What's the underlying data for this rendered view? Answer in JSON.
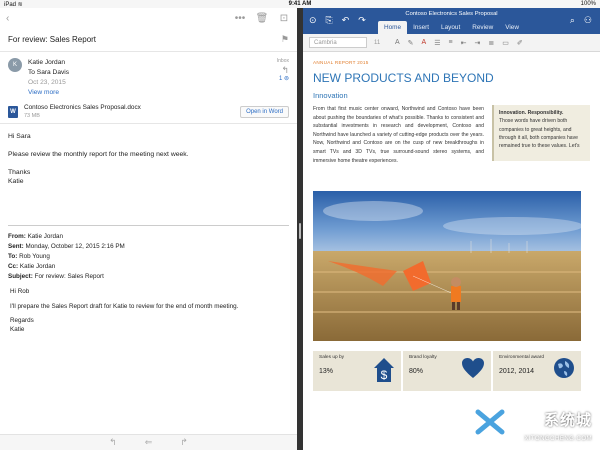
{
  "status": {
    "time": "9:41 AM",
    "battery": "100%"
  },
  "mail": {
    "subject": "For review: Sales Report",
    "sender_initial": "K",
    "sender_name": "Katie Jordan",
    "to": "To Sara Davis",
    "date": "Oct 23, 2015",
    "view_more": "View more",
    "inbox_label": "Inbox",
    "thread_count": "1",
    "attachment_name": "Contoso Electronics Sales Proposal.docx",
    "attachment_size": "73 MB",
    "attachment_type": "doc",
    "open_in_word": "Open in Word",
    "body": [
      "Hi Sara",
      "Please review the monthly report for the meeting next week.",
      "Thanks\nKatie"
    ],
    "quoted": {
      "from_label": "From:",
      "from": "Katie Jordan",
      "sent_label": "Sent:",
      "sent": "Monday, October 12, 2015 2:16 PM",
      "to_label": "To:",
      "to": "Rob Young",
      "cc_label": "Cc:",
      "cc": "Katie Jordan",
      "subject_label": "Subject:",
      "subject": "For review: Sales Report",
      "body": [
        "Hi Rob",
        "I'll prepare the Sales Report draft for Katie to review for the end of month meeting.",
        "Regards\nKatie"
      ]
    }
  },
  "word": {
    "doc_title": "Contoso Electronics Sales Proposal",
    "tabs": [
      "Home",
      "Insert",
      "Layout",
      "Review",
      "View"
    ],
    "active_tab": "Home",
    "font": "Cambria",
    "font_size": "11",
    "doc_header": "ANNUAL REPORT 2015",
    "title": "NEW PRODUCTS AND BEYOND",
    "subtitle": "Innovation",
    "paragraph": "From that first music center onward, Northwind and Contoso have been about pushing the boundaries of what's possible. Thanks to consistent and substantial investments in research and development, Contoso and Northwind have launched a variety of cutting-edge products over the years. Now, Northwind and Contoso are on the cusp of new breakthroughs in smart TVs and 3D TVs, true surround-sound stereo systems, and immersive home theatre experiences.",
    "sidebox_title": "Innovation. Responsibility.",
    "sidebox_text": "Those words have driven both companies to great heights, and through it all, both companies have remained true to these values. Let's",
    "stats": [
      {
        "label": "Sales up by",
        "value": "13%",
        "icon": "dollar-house-icon"
      },
      {
        "label": "Brand loyalty",
        "value": "80%",
        "icon": "heart-icon"
      },
      {
        "label": "Environmental award",
        "value": "2012, 2014",
        "icon": "globe-icon"
      }
    ]
  },
  "watermark": {
    "cn": "系统城",
    "en": "XITONGCHENG.COM"
  },
  "colors": {
    "word_blue": "#2b579a",
    "title_blue": "#2e75b6",
    "link_blue": "#2b6cc4",
    "stat_bg": "#e9e5d7"
  }
}
